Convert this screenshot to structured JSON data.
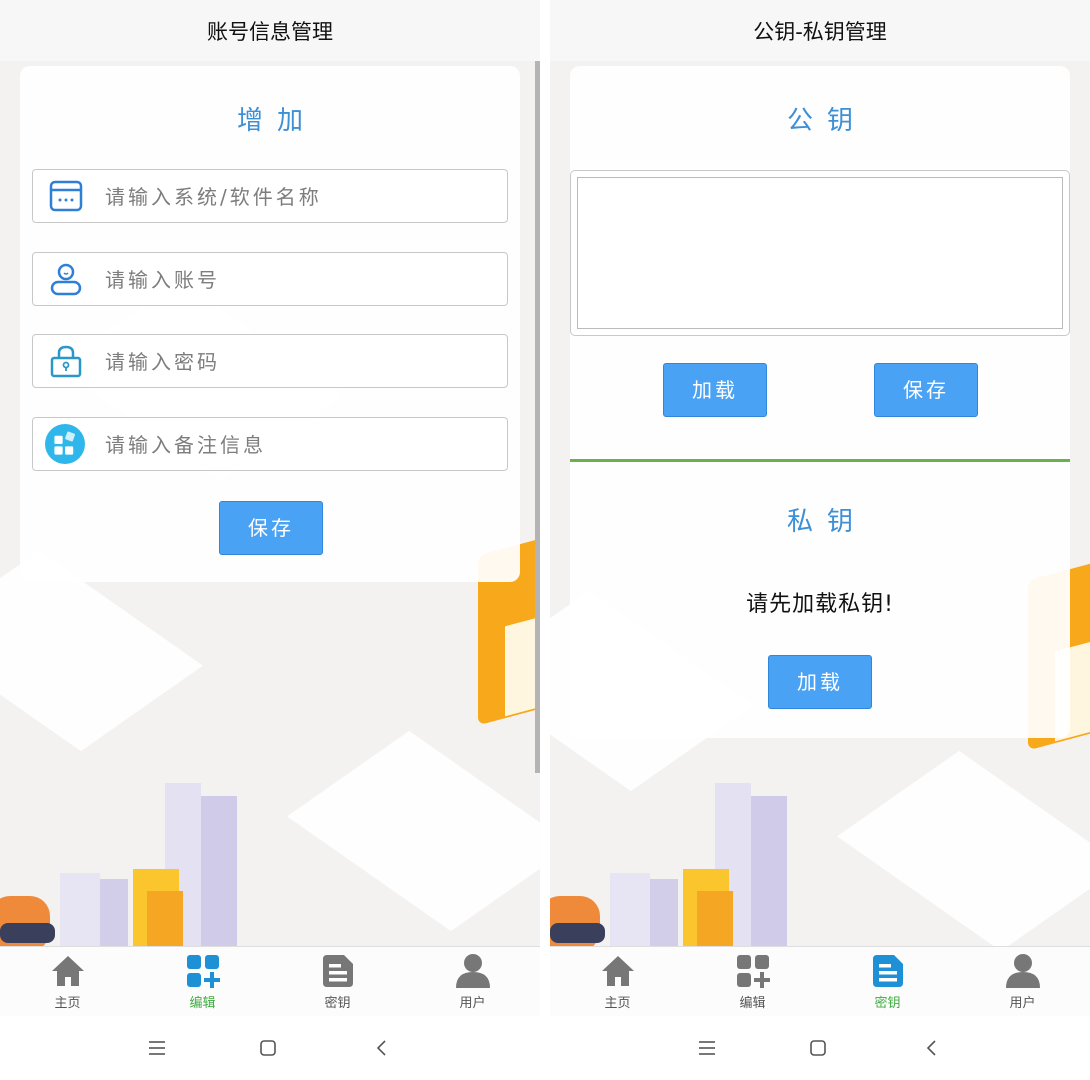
{
  "left_screen": {
    "title": "账号信息管理",
    "card_title": "增加",
    "fields": [
      {
        "icon": "window-icon",
        "placeholder": "请输入系统/软件名称",
        "value": ""
      },
      {
        "icon": "user-icon",
        "placeholder": "请输入账号",
        "value": ""
      },
      {
        "icon": "lock-icon",
        "placeholder": "请输入密码",
        "value": ""
      },
      {
        "icon": "blocks-icon",
        "placeholder": "请输入备注信息",
        "value": ""
      }
    ],
    "save_label": "保存",
    "tabs": [
      {
        "label": "主页",
        "icon": "home-icon",
        "active": false
      },
      {
        "label": "编辑",
        "icon": "grid-plus-icon",
        "active": true
      },
      {
        "label": "密钥",
        "icon": "document-icon",
        "active": false
      },
      {
        "label": "用户",
        "icon": "person-icon",
        "active": false
      }
    ]
  },
  "right_screen": {
    "title": "公钥-私钥管理",
    "public_key": {
      "title": "公钥",
      "value": "",
      "load_label": "加载",
      "save_label": "保存"
    },
    "private_key": {
      "title": "私钥",
      "message": "请先加载私钥!",
      "load_label": "加载"
    },
    "tabs": [
      {
        "label": "主页",
        "icon": "home-icon",
        "active": false
      },
      {
        "label": "编辑",
        "icon": "grid-plus-icon",
        "active": false
      },
      {
        "label": "密钥",
        "icon": "document-icon",
        "active": true
      },
      {
        "label": "用户",
        "icon": "person-icon",
        "active": false
      }
    ]
  },
  "colors": {
    "accent_blue": "#3d8fd6",
    "button_blue": "#4aa2f5",
    "active_tab_green": "#3fae3f",
    "divider_green": "#6ab04c"
  },
  "system_nav": [
    "menu-icon",
    "home-square-icon",
    "back-icon"
  ]
}
